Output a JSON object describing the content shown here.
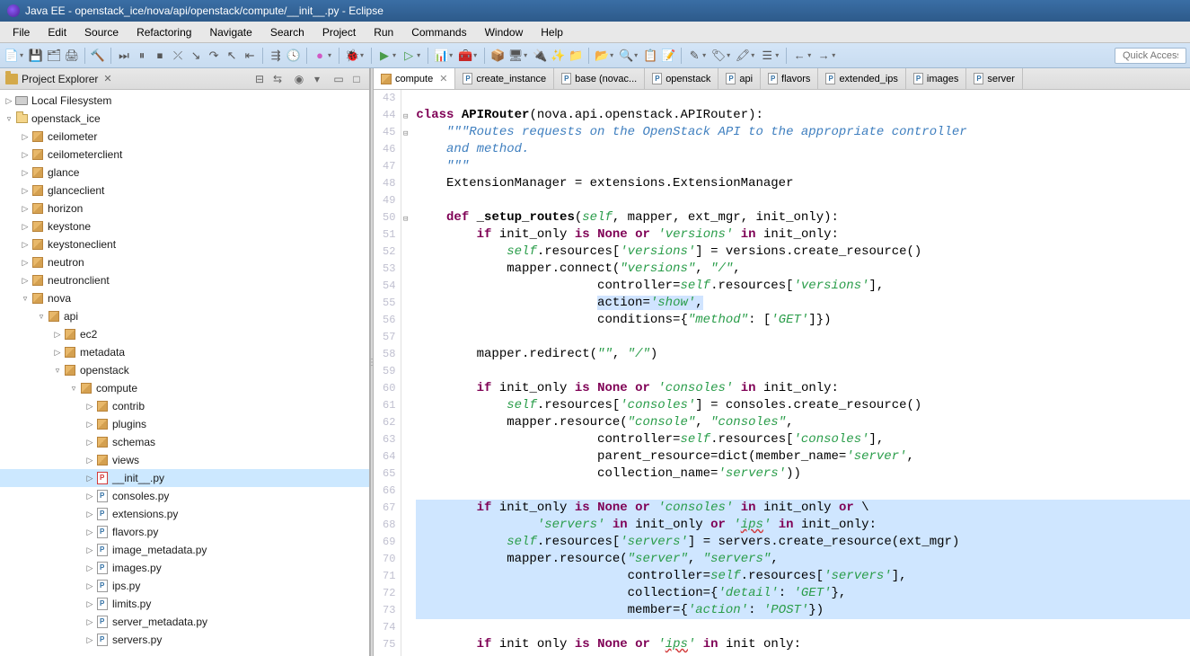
{
  "window": {
    "title": "Java EE - openstack_ice/nova/api/openstack/compute/__init__.py - Eclipse"
  },
  "menubar": [
    "File",
    "Edit",
    "Source",
    "Refactoring",
    "Navigate",
    "Search",
    "Project",
    "Run",
    "Commands",
    "Window",
    "Help"
  ],
  "quick_access_placeholder": "Quick Access",
  "explorer": {
    "title": "Project Explorer",
    "tree": [
      {
        "depth": 0,
        "tw": "▷",
        "icon": "drive",
        "label": "Local Filesystem"
      },
      {
        "depth": 0,
        "tw": "▿",
        "icon": "proj",
        "label": "openstack_ice"
      },
      {
        "depth": 1,
        "tw": "▷",
        "icon": "pkg",
        "label": "ceilometer"
      },
      {
        "depth": 1,
        "tw": "▷",
        "icon": "pkg",
        "label": "ceilometerclient"
      },
      {
        "depth": 1,
        "tw": "▷",
        "icon": "pkg",
        "label": "glance"
      },
      {
        "depth": 1,
        "tw": "▷",
        "icon": "pkg",
        "label": "glanceclient"
      },
      {
        "depth": 1,
        "tw": "▷",
        "icon": "pkg",
        "label": "horizon"
      },
      {
        "depth": 1,
        "tw": "▷",
        "icon": "pkg",
        "label": "keystone"
      },
      {
        "depth": 1,
        "tw": "▷",
        "icon": "pkg",
        "label": "keystoneclient"
      },
      {
        "depth": 1,
        "tw": "▷",
        "icon": "pkg",
        "label": "neutron"
      },
      {
        "depth": 1,
        "tw": "▷",
        "icon": "pkg",
        "label": "neutronclient"
      },
      {
        "depth": 1,
        "tw": "▿",
        "icon": "pkg",
        "label": "nova"
      },
      {
        "depth": 2,
        "tw": "▿",
        "icon": "pkg",
        "label": "api"
      },
      {
        "depth": 3,
        "tw": "▷",
        "icon": "pkg",
        "label": "ec2"
      },
      {
        "depth": 3,
        "tw": "▷",
        "icon": "pkg",
        "label": "metadata"
      },
      {
        "depth": 3,
        "tw": "▿",
        "icon": "pkg",
        "label": "openstack"
      },
      {
        "depth": 4,
        "tw": "▿",
        "icon": "pkg",
        "label": "compute"
      },
      {
        "depth": 5,
        "tw": "▷",
        "icon": "pkg",
        "label": "contrib"
      },
      {
        "depth": 5,
        "tw": "▷",
        "icon": "pkg",
        "label": "plugins"
      },
      {
        "depth": 5,
        "tw": "▷",
        "icon": "pkg",
        "label": "schemas"
      },
      {
        "depth": 5,
        "tw": "▷",
        "icon": "pkg",
        "label": "views"
      },
      {
        "depth": 5,
        "tw": "▷",
        "icon": "py-active",
        "label": "__init__.py",
        "selected": true
      },
      {
        "depth": 5,
        "tw": "▷",
        "icon": "py",
        "label": "consoles.py"
      },
      {
        "depth": 5,
        "tw": "▷",
        "icon": "py",
        "label": "extensions.py"
      },
      {
        "depth": 5,
        "tw": "▷",
        "icon": "py",
        "label": "flavors.py"
      },
      {
        "depth": 5,
        "tw": "▷",
        "icon": "py",
        "label": "image_metadata.py"
      },
      {
        "depth": 5,
        "tw": "▷",
        "icon": "py",
        "label": "images.py"
      },
      {
        "depth": 5,
        "tw": "▷",
        "icon": "py",
        "label": "ips.py"
      },
      {
        "depth": 5,
        "tw": "▷",
        "icon": "py",
        "label": "limits.py"
      },
      {
        "depth": 5,
        "tw": "▷",
        "icon": "py",
        "label": "server_metadata.py"
      },
      {
        "depth": 5,
        "tw": "▷",
        "icon": "py",
        "label": "servers.py"
      }
    ]
  },
  "tabs": [
    {
      "label": "compute",
      "active": true,
      "icon": "pkg"
    },
    {
      "label": "create_instance",
      "icon": "py"
    },
    {
      "label": "base (novac...",
      "icon": "py"
    },
    {
      "label": "openstack",
      "icon": "py"
    },
    {
      "label": "api",
      "icon": "py"
    },
    {
      "label": "flavors",
      "icon": "py"
    },
    {
      "label": "extended_ips",
      "icon": "py"
    },
    {
      "label": "images",
      "icon": "py"
    },
    {
      "label": "server",
      "icon": "py"
    }
  ],
  "code": {
    "first_line": 43,
    "fold_lines": [
      44,
      45,
      50
    ],
    "highlight_start": 67,
    "highlight_end": 73,
    "lines": [
      "",
      "<span class='kw'>class</span> <span class='fn'>APIRouter</span>(nova.api.openstack.APIRouter):",
      "    <span class='doc'>\"\"\"Routes requests on the OpenStack API to the appropriate controller</span>",
      "    <span class='doc'>and method.</span>",
      "    <span class='doc'>\"\"\"</span>",
      "    ExtensionManager = extensions.ExtensionManager",
      "",
      "    <span class='kw'>def</span> <span class='fn'>_setup_routes</span>(<span class='self'>self</span>, mapper, ext_mgr, init_only):",
      "        <span class='kw'>if</span> init_only <span class='kw'>is</span> <span class='kw'>None</span> <span class='kw'>or</span> <span class='str'>'versions'</span> <span class='kw'>in</span> init_only:",
      "            <span class='self'>self</span>.resources[<span class='str'>'versions'</span>] = versions.create_resource()",
      "            mapper.connect(<span class='str'>\"versions\"</span>, <span class='str'>\"/\"</span>,",
      "                        controller=<span class='self'>self</span>.resources[<span class='str'>'versions'</span>],",
      "                        <span class='hlbg'>action=<span class='str'>'show'</span>,</span>",
      "                        conditions={<span class='str'>\"method\"</span>: [<span class='str'>'GET'</span>]})",
      "",
      "        mapper.redirect(<span class='str'>\"\"</span>, <span class='str'>\"/\"</span>)",
      "",
      "        <span class='kw'>if</span> init_only <span class='kw'>is</span> <span class='kw'>None</span> <span class='kw'>or</span> <span class='str'>'consoles'</span> <span class='kw'>in</span> init_only:",
      "            <span class='self'>self</span>.resources[<span class='str'>'consoles'</span>] = consoles.create_resource()",
      "            mapper.resource(<span class='str'>\"console\"</span>, <span class='str'>\"consoles\"</span>,",
      "                        controller=<span class='self'>self</span>.resources[<span class='str'>'consoles'</span>],",
      "                        parent_resource=dict(member_name=<span class='str'>'server'</span>,",
      "                        collection_name=<span class='str'>'servers'</span>))",
      "",
      "        <span class='kw'>if</span> init_only <span class='kw'>is</span> <span class='kw'>None</span> <span class='kw'>or</span> <span class='str'>'consoles'</span> <span class='kw'>in</span> init_only <span class='kw'>or</span> \\",
      "                <span class='str'>'servers'</span> <span class='kw'>in</span> init_only <span class='kw'>or</span> <span class='str'>'<span class='wavy'>ips</span>'</span> <span class='kw'>in</span> init_only:",
      "            <span class='self'>self</span>.resources[<span class='str'>'servers'</span>] = servers.create_resource(ext_mgr)",
      "            mapper.resource(<span class='str'>\"server\"</span>, <span class='str'>\"servers\"</span>,",
      "                            controller=<span class='self'>self</span>.resources[<span class='str'>'servers'</span>],",
      "                            collection={<span class='str'>'detail'</span>: <span class='str'>'GET'</span>},",
      "                            member={<span class='str'>'action'</span>: <span class='str'>'POST'</span>})",
      "",
      "        <span class='kw'>if</span> init only <span class='kw'>is</span> <span class='kw'>None</span> <span class='kw'>or</span> <span class='str'>'<span class='wavy'>ips</span>'</span> <span class='kw'>in</span> init only:"
    ]
  }
}
